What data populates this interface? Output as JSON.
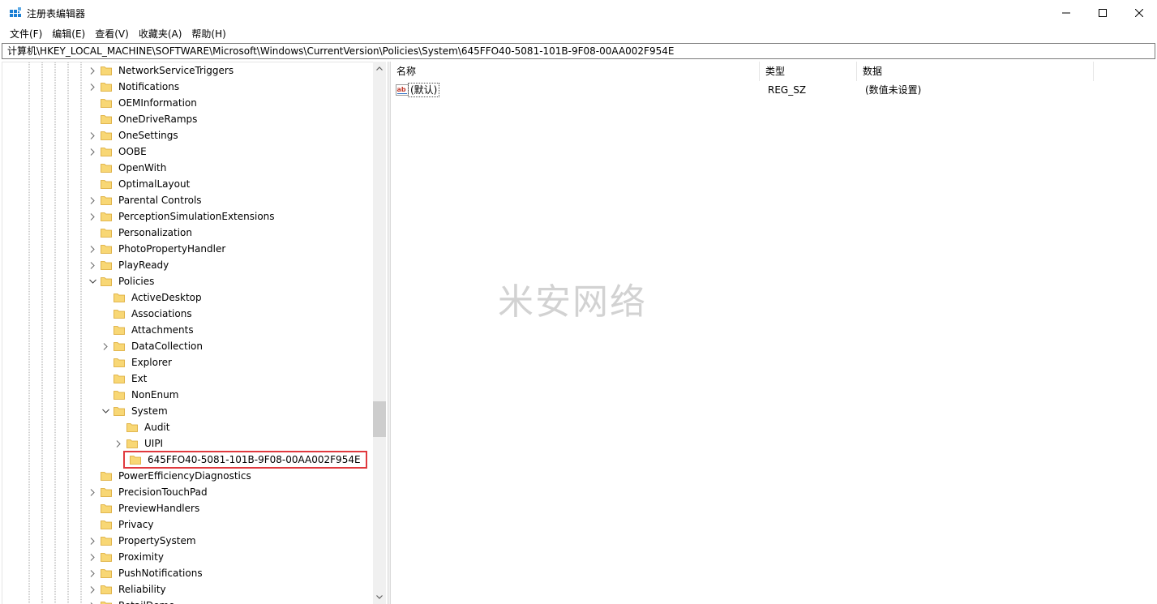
{
  "window": {
    "title": "注册表编辑器",
    "icon": "regedit-icon"
  },
  "menu": [
    {
      "label": "文件(F)"
    },
    {
      "label": "编辑(E)"
    },
    {
      "label": "查看(V)"
    },
    {
      "label": "收藏夹(A)"
    },
    {
      "label": "帮助(H)"
    }
  ],
  "address": {
    "path": "计算机\\HKEY_LOCAL_MACHINE\\SOFTWARE\\Microsoft\\Windows\\CurrentVersion\\Policies\\System\\645FFO40-5081-101B-9F08-00AA002F954E"
  },
  "tree": {
    "items": [
      {
        "label": "NetworkServiceTriggers",
        "depth": 0,
        "expander": "collapsed"
      },
      {
        "label": "Notifications",
        "depth": 0,
        "expander": "collapsed"
      },
      {
        "label": "OEMInformation",
        "depth": 0,
        "expander": "none"
      },
      {
        "label": "OneDriveRamps",
        "depth": 0,
        "expander": "none"
      },
      {
        "label": "OneSettings",
        "depth": 0,
        "expander": "collapsed"
      },
      {
        "label": "OOBE",
        "depth": 0,
        "expander": "collapsed"
      },
      {
        "label": "OpenWith",
        "depth": 0,
        "expander": "none"
      },
      {
        "label": "OptimalLayout",
        "depth": 0,
        "expander": "none"
      },
      {
        "label": "Parental Controls",
        "depth": 0,
        "expander": "collapsed"
      },
      {
        "label": "PerceptionSimulationExtensions",
        "depth": 0,
        "expander": "collapsed"
      },
      {
        "label": "Personalization",
        "depth": 0,
        "expander": "none"
      },
      {
        "label": "PhotoPropertyHandler",
        "depth": 0,
        "expander": "collapsed"
      },
      {
        "label": "PlayReady",
        "depth": 0,
        "expander": "collapsed"
      },
      {
        "label": "Policies",
        "depth": 0,
        "expander": "expanded"
      },
      {
        "label": "ActiveDesktop",
        "depth": 1,
        "expander": "none"
      },
      {
        "label": "Associations",
        "depth": 1,
        "expander": "none"
      },
      {
        "label": "Attachments",
        "depth": 1,
        "expander": "none"
      },
      {
        "label": "DataCollection",
        "depth": 1,
        "expander": "collapsed"
      },
      {
        "label": "Explorer",
        "depth": 1,
        "expander": "none"
      },
      {
        "label": "Ext",
        "depth": 1,
        "expander": "none"
      },
      {
        "label": "NonEnum",
        "depth": 1,
        "expander": "none"
      },
      {
        "label": "System",
        "depth": 1,
        "expander": "expanded"
      },
      {
        "label": "Audit",
        "depth": 2,
        "expander": "none"
      },
      {
        "label": "UIPI",
        "depth": 2,
        "expander": "collapsed"
      },
      {
        "label": "645FFO40-5081-101B-9F08-00AA002F954E",
        "depth": 2,
        "expander": "none",
        "selected": true
      },
      {
        "label": "PowerEfficiencyDiagnostics",
        "depth": 0,
        "expander": "none"
      },
      {
        "label": "PrecisionTouchPad",
        "depth": 0,
        "expander": "collapsed"
      },
      {
        "label": "PreviewHandlers",
        "depth": 0,
        "expander": "none"
      },
      {
        "label": "Privacy",
        "depth": 0,
        "expander": "none"
      },
      {
        "label": "PropertySystem",
        "depth": 0,
        "expander": "collapsed"
      },
      {
        "label": "Proximity",
        "depth": 0,
        "expander": "collapsed"
      },
      {
        "label": "PushNotifications",
        "depth": 0,
        "expander": "collapsed"
      },
      {
        "label": "Reliability",
        "depth": 0,
        "expander": "collapsed"
      },
      {
        "label": "RetailDemo",
        "depth": 0,
        "expander": "collapsed"
      }
    ]
  },
  "list": {
    "columns": [
      {
        "label": "名称"
      },
      {
        "label": "类型"
      },
      {
        "label": "数据"
      }
    ],
    "rows": [
      {
        "icon": "string-value-icon",
        "name": "(默认)",
        "type": "REG_SZ",
        "data": "(数值未设置)"
      }
    ]
  },
  "scrollbar": {
    "position_fraction": 0.68,
    "visible_fraction": 0.07
  },
  "watermark": "米安网络",
  "colors": {
    "folder": "#f8d775",
    "folder_edge": "#d9a62e",
    "selection_border": "#e0393e",
    "scrollbar_track": "#f0f0f0",
    "scrollbar_thumb": "#cdcdcd"
  }
}
